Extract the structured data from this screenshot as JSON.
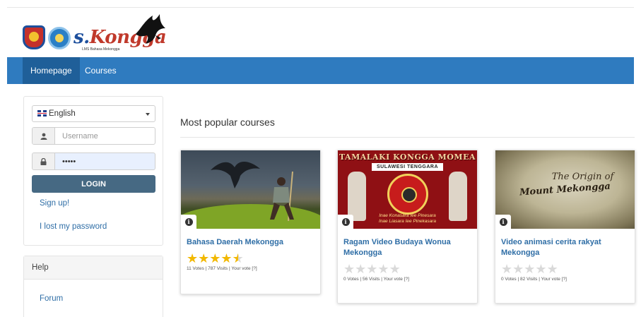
{
  "logo": {
    "brand_s": "s.",
    "brand_rest": "Kongga",
    "tagline": "LMS Bahasa Mekongga"
  },
  "nav": {
    "items": [
      {
        "label": "Homepage"
      },
      {
        "label": "Courses"
      }
    ]
  },
  "login": {
    "language": "English",
    "username_placeholder": "Username",
    "password_value": "•••••",
    "login_label": "LOGIN",
    "signup_label": "Sign up!",
    "lost_label": "I lost my password"
  },
  "help": {
    "title": "Help",
    "forum_label": "Forum"
  },
  "main": {
    "section_title": "Most popular courses",
    "courses": [
      {
        "title": "Bahasa Daerah Mekongga",
        "rating": 4.5,
        "meta": "11 Votes | 787 Visits | Your vote [?]"
      },
      {
        "title": "Ragam Video Budaya Wonua Mekongga",
        "rating": 0,
        "meta": "0 Votes | 56 Visits | Your vote [?]",
        "thumb_banner": "TAMALAKI KONGGA MOMEA",
        "thumb_sub": "SULAWESI TENGGARA",
        "thumb_motto_1": "Inae Konasara Iee Pinesara",
        "thumb_motto_2": "Inae Liasara Iee Pinekasara"
      },
      {
        "title": "Video animasi cerita rakyat Mekongga",
        "rating": 0,
        "meta": "0 Votes | 82 Visits | Your vote [?]",
        "thumb_line_1": "The Origin of",
        "thumb_line_2": "Mount Mekongga"
      }
    ]
  },
  "colors": {
    "navbar": "#2f7bbf",
    "nav_active": "#1f5f99",
    "login_button": "#466983",
    "link": "#2f6ea6",
    "star": "#f2b800"
  }
}
